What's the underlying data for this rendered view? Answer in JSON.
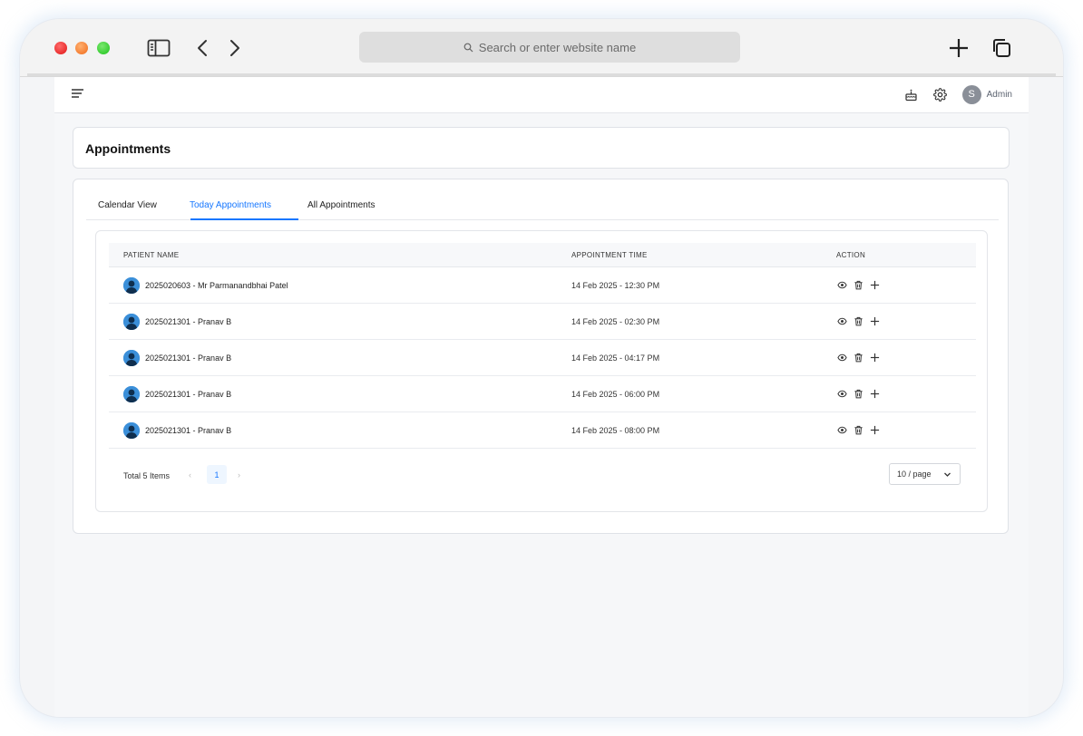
{
  "browser": {
    "address_placeholder": "Search or enter website name"
  },
  "topbar": {
    "user_initial": "S",
    "user_name": "Admin"
  },
  "page": {
    "title": "Appointments"
  },
  "tabs": [
    {
      "label": "Calendar View",
      "active": false
    },
    {
      "label": "Today Appointments",
      "active": true
    },
    {
      "label": "All Appointments",
      "active": false
    }
  ],
  "table": {
    "columns": [
      "PATIENT NAME",
      "APPOINTMENT TIME",
      "ACTION"
    ],
    "rows": [
      {
        "patient": "2025020603 - Mr Parmanandbhai Patel",
        "time": "14 Feb 2025 - 12:30 PM"
      },
      {
        "patient": "2025021301 - Pranav B",
        "time": "14 Feb 2025 - 02:30 PM"
      },
      {
        "patient": "2025021301 - Pranav B",
        "time": "14 Feb 2025 - 04:17 PM"
      },
      {
        "patient": "2025021301 - Pranav B",
        "time": "14 Feb 2025 - 06:00 PM"
      },
      {
        "patient": "2025021301 - Pranav B",
        "time": "14 Feb 2025 - 08:00 PM"
      }
    ],
    "action_icons": [
      "eye-icon",
      "trash-icon",
      "plus-icon"
    ]
  },
  "pagination": {
    "total": "Total 5 Items",
    "current_page": "1",
    "page_size": "10 / page"
  },
  "colors": {
    "accent": "#1677ff",
    "avatar": "#3b8fd9"
  }
}
